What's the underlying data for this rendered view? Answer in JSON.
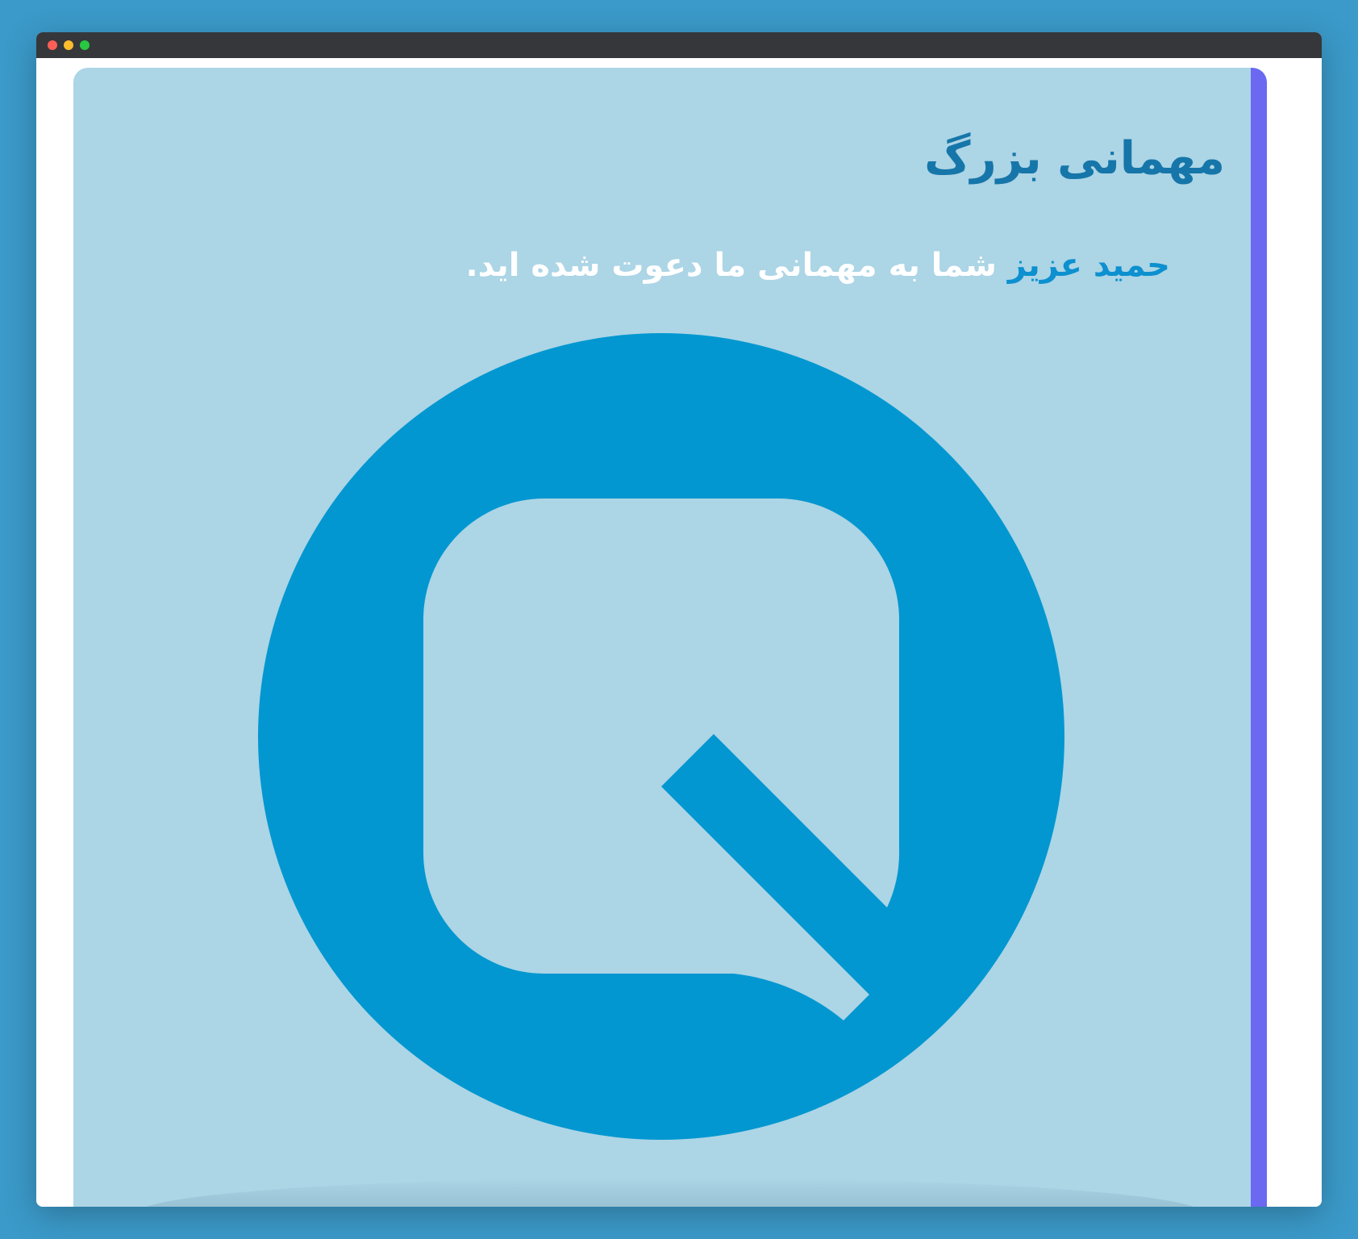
{
  "window": {
    "controls": [
      "close",
      "minimize",
      "maximize"
    ]
  },
  "page": {
    "title": "مهمانی بزرگ",
    "invite": {
      "name": "حمید عزیز",
      "message": " شما به مهمانی ما دعوت شده اید."
    },
    "logo": {
      "icon": "q-logo-icon"
    }
  },
  "colors": {
    "page_background": "#3b9ac9",
    "window_bar": "#35373a",
    "card_background": "#acd5e6",
    "accent": "#6b68f2",
    "title": "#1676a9",
    "name": "#0d90cf",
    "logo": "#0297d0"
  }
}
